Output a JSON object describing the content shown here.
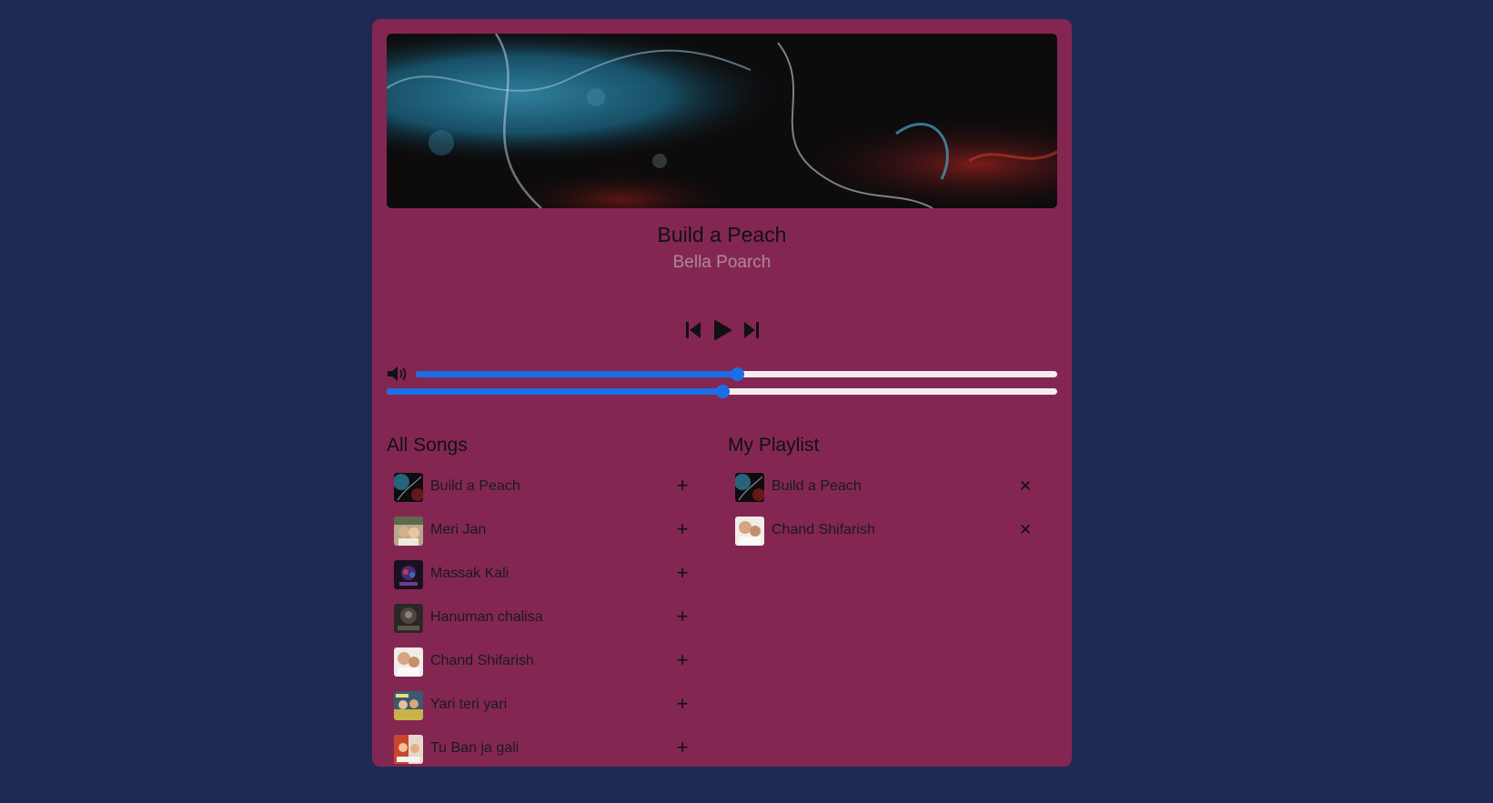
{
  "colors": {
    "page_background": "#1e2a54",
    "player_background": "#832752",
    "slider_accent": "#1a6fe8",
    "slider_track": "#f4ecee",
    "artist_text": "#b0879a"
  },
  "now_playing": {
    "title": "Build a Peach",
    "artist": "Bella Poarch",
    "cover_icon": "abstract-marbled-artwork"
  },
  "controls": {
    "previous_icon": "skip-previous-icon",
    "play_icon": "play-icon",
    "next_icon": "skip-next-icon"
  },
  "volume": {
    "icon": "volume-icon",
    "level": 0.5
  },
  "seek": {
    "position": 0.5
  },
  "all_songs": {
    "heading": "All Songs",
    "action_icon": "plus-icon",
    "action_glyph": "+",
    "items": [
      {
        "name": "Build a Peach",
        "thumb": "thumb-a"
      },
      {
        "name": "Meri Jan",
        "thumb": "thumb-b"
      },
      {
        "name": "Massak Kali",
        "thumb": "thumb-c"
      },
      {
        "name": "Hanuman chalisa",
        "thumb": "thumb-d"
      },
      {
        "name": "Chand Shifarish",
        "thumb": "thumb-e"
      },
      {
        "name": "Yari teri yari",
        "thumb": "thumb-f"
      },
      {
        "name": "Tu Ban ja gali",
        "thumb": "thumb-g"
      }
    ]
  },
  "my_playlist": {
    "heading": "My Playlist",
    "action_icon": "remove-icon",
    "action_glyph": "✕",
    "items": [
      {
        "name": "Build a Peach",
        "thumb": "thumb-a"
      },
      {
        "name": "Chand Shifarish",
        "thumb": "thumb-e"
      }
    ]
  }
}
